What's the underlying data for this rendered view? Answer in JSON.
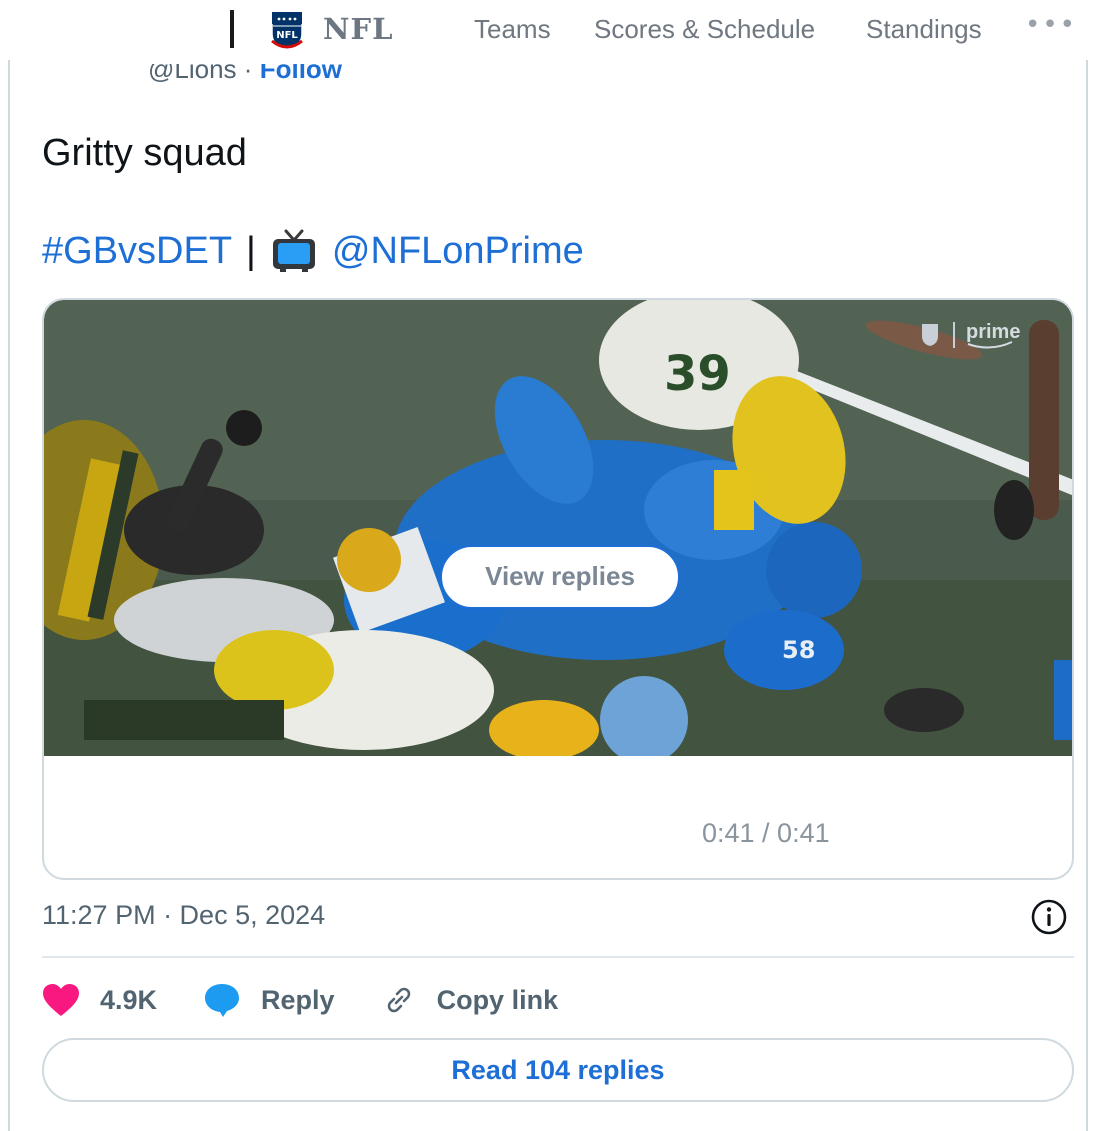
{
  "nav": {
    "brand": "NFL",
    "links": [
      "Teams",
      "Scores & Schedule",
      "Standings"
    ],
    "more_icon": "ellipsis-icon"
  },
  "tweet": {
    "handle": "@Lions",
    "separator": "·",
    "follow_label": "Follow",
    "text": "Gritty squad",
    "hashtag": "#GBvsDET",
    "pipe": "|",
    "tv_icon": "television-emoji-icon",
    "mention": "@NFLonPrime"
  },
  "video": {
    "overlay_button": "View replies",
    "broadcaster_logo": "prime",
    "jersey_numbers": [
      "39",
      "58"
    ],
    "duration": "0:41 / 0:41"
  },
  "meta": {
    "timestamp": "11:27 PM · Dec 5, 2024",
    "info_icon": "info-icon"
  },
  "actions": {
    "likes": "4.9K",
    "reply_label": "Reply",
    "copy_label": "Copy link",
    "read_replies_label": "Read 104 replies"
  },
  "colors": {
    "link_blue": "#1d6fd6",
    "like_pink": "#f91880",
    "reply_blue": "#1d9bf0",
    "border": "#cfd9de"
  }
}
